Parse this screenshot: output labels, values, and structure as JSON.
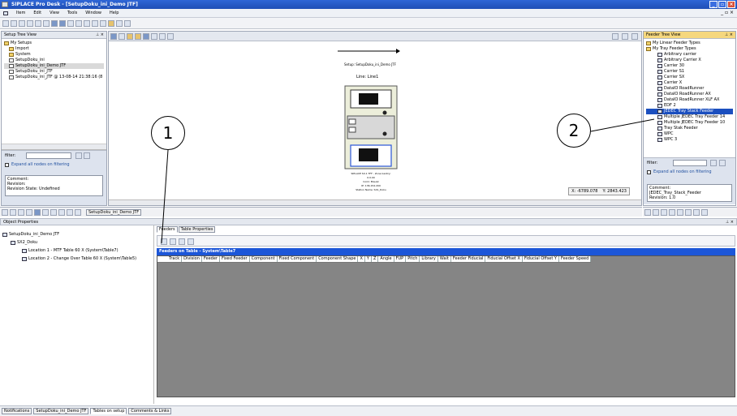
{
  "window": {
    "title": "SIPLACE Pro Desk - [SetupDoku_ini_Demo JTF]",
    "menu": [
      "Item",
      "Edit",
      "View",
      "Tools",
      "Window",
      "Help"
    ],
    "mdi_controls": "_ ▫ ×"
  },
  "setup_tree": {
    "title": "Setup Tree View",
    "items": [
      "My Setups",
      "Import",
      "System",
      "SetupDoku_ini",
      "SetupDoku_ini_Demo JTF",
      "SetupDoku_ini_JTF",
      "SetupDoku_ini_JTF @ 13-08-14 21:38:16 (8"
    ],
    "filter_label": "filter:",
    "expand_label": "Expand all nodes on filtering",
    "comment_label": "Comment:",
    "revision_label": "Revision:",
    "revision_state": "Revision State: Undefined"
  },
  "canvas": {
    "doc_title": "Setup: SetupDoku_ini_Demo JTF",
    "line_label": "Line: Line1",
    "machine_caption": [
      "SIPLACE SX-1 TFF - Zone Gantry: 0.0.00",
      "Coim: Blauzz",
      "IP: 136.154.200",
      "Station Name: SX1_Doku"
    ],
    "coord_x": "X: -6789.078",
    "coord_y": "Y: 2843.423",
    "doc_tab": "SetupDoku_ini_Demo JTF"
  },
  "feeder_tree": {
    "title": "Feeder Tree View",
    "groups": [
      "My Linear Feeder Types",
      "My Tray Feeder Types"
    ],
    "items": [
      "Arbitrary carrier",
      "Arbitrary Carrier X",
      "Carrier 30",
      "Carrier S1",
      "Carrier SX",
      "Carrier X",
      "DataIO RoadRunner",
      "DataIO RoadRunner AX",
      "DataIO RoadRunner XLF AX",
      "EDF 2",
      "JEDEC Tray Stack Feeder",
      "Multiple JEDEC Tray Feeder 14",
      "Multiple JEDEC Tray Feeder 10",
      "Tray Stak Feeder",
      "WPC",
      "WPC 3"
    ],
    "selected_index": 10,
    "filter_label": "filter:",
    "expand_label": "Expand all nodes on filtering",
    "comment_label": "Comment:",
    "comment_value": "JEDEC_Tray_Stack_Feeder",
    "revision": "Revision: 1.0"
  },
  "object_props": {
    "title": "Object Properties",
    "items": [
      "SetupDoku_ini_Demo JTF",
      "SX2_Doku",
      "Location 1 - MTF Table 60 X (System\\Table7)",
      "Location 2 - Change Over Table 60 X (System\\Table5)"
    ],
    "tabs": [
      "Feeders",
      "Table Properties"
    ],
    "grid_title": "Feeders on Table - System\\Table7",
    "columns": [
      "Track",
      "Division",
      "Feeder",
      "Fixed Feeder",
      "Component",
      "Fixed Component",
      "Component Shape",
      "X",
      "Y",
      "Z",
      "Angle",
      "FUP",
      "Pitch",
      "Library",
      "Wait",
      "Feeder Fiducial",
      "Fiducial Offset X",
      "Fiducial Offset Y",
      "Feeder Speed"
    ]
  },
  "status_tabs": [
    "Notifications",
    "SetupDoku_ini_Demo JTF",
    "Tables on setup",
    "Comments & Links"
  ],
  "callouts": [
    "1",
    "2"
  ]
}
